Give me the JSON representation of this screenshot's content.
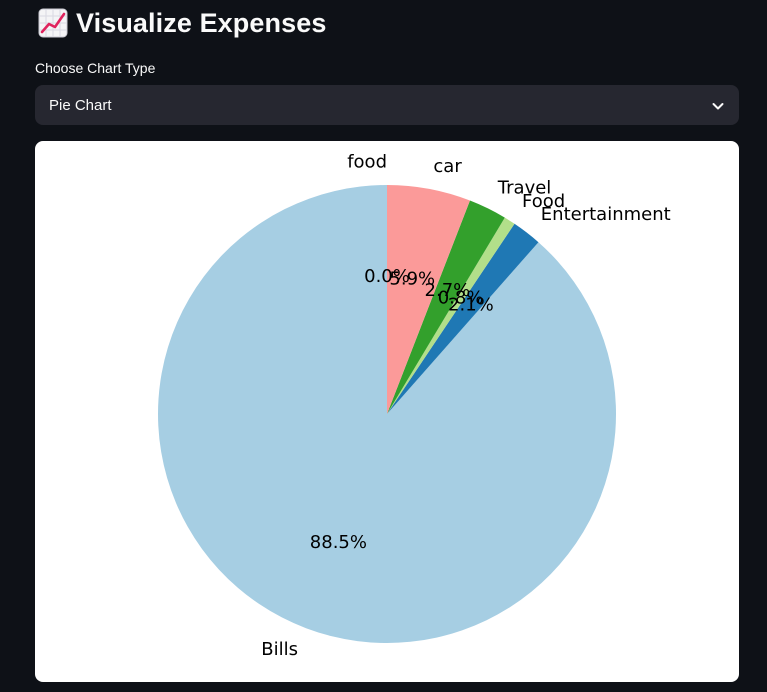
{
  "header": {
    "icon": "chart-increasing-icon",
    "title": "Visualize Expenses"
  },
  "chart_type_select": {
    "label": "Choose Chart Type",
    "value": "Pie Chart"
  },
  "chart_data": {
    "type": "pie",
    "start_angle_deg": 90,
    "direction": "counterclockwise",
    "slices": [
      {
        "label": "Bills",
        "percent": 88.5,
        "pct_label": "88.5%",
        "color": "#a6cee3"
      },
      {
        "label": "Entertainment",
        "percent": 2.1,
        "pct_label": "2.1%",
        "color": "#1f78b4"
      },
      {
        "label": "Food",
        "percent": 0.8,
        "pct_label": "0.8%",
        "color": "#b2df8a"
      },
      {
        "label": "Travel",
        "percent": 2.7,
        "pct_label": "2.7%",
        "color": "#33a02c"
      },
      {
        "label": "car",
        "percent": 5.9,
        "pct_label": "5.9%",
        "color": "#fb9a99"
      },
      {
        "label": "food",
        "percent": 0.0,
        "pct_label": "0.0%",
        "color": "#e31a1c"
      }
    ]
  }
}
